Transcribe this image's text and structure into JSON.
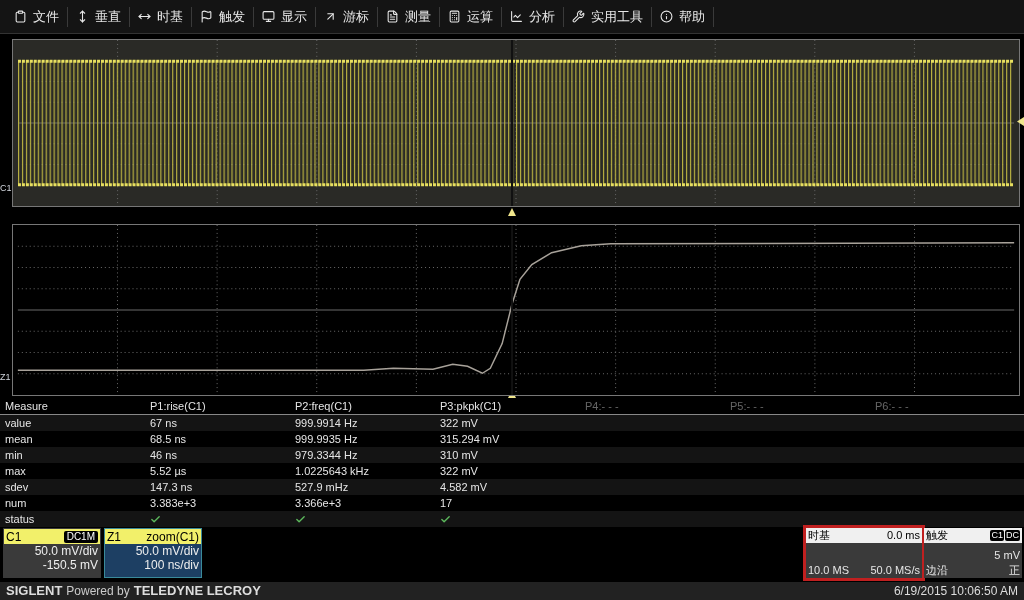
{
  "menu": [
    {
      "label": "文件"
    },
    {
      "label": "垂直"
    },
    {
      "label": "时基"
    },
    {
      "label": "触发"
    },
    {
      "label": "显示"
    },
    {
      "label": "游标"
    },
    {
      "label": "测量"
    },
    {
      "label": "运算"
    },
    {
      "label": "分析"
    },
    {
      "label": "实用工具"
    },
    {
      "label": "帮助"
    }
  ],
  "waveforms": [
    {
      "label": "C1",
      "kind": "square"
    },
    {
      "label": "Z1",
      "kind": "edge"
    }
  ],
  "measure": {
    "columns": [
      {
        "label": "Measure",
        "active": true
      },
      {
        "label": "P1:rise(C1)",
        "active": true
      },
      {
        "label": "P2:freq(C1)",
        "active": true
      },
      {
        "label": "P3:pkpk(C1)",
        "active": true
      },
      {
        "label": "P4:- - -",
        "active": false
      },
      {
        "label": "P5:- - -",
        "active": false
      },
      {
        "label": "P6:- - -",
        "active": false
      }
    ],
    "rows": [
      {
        "cells": [
          "value",
          "67 ns",
          "999.9914 Hz",
          "322 mV"
        ]
      },
      {
        "cells": [
          "mean",
          "68.5 ns",
          "999.9935 Hz",
          "315.294 mV"
        ]
      },
      {
        "cells": [
          "min",
          "46 ns",
          "979.3344 Hz",
          "310 mV"
        ]
      },
      {
        "cells": [
          "max",
          "5.52 µs",
          "1.0225643 kHz",
          "322 mV"
        ]
      },
      {
        "cells": [
          "sdev",
          "147.3 ns",
          "527.9 mHz",
          "4.582 mV"
        ]
      },
      {
        "cells": [
          "num",
          "3.383e+3",
          "3.366e+3",
          "17"
        ]
      }
    ],
    "status": {
      "label": "status",
      "checks": [
        true,
        true,
        true
      ]
    }
  },
  "channels": [
    {
      "name": "C1",
      "tag": "DC1M",
      "lines": [
        "50.0 mV/div",
        "-150.5 mV"
      ],
      "selected": false
    },
    {
      "name": "Z1",
      "tag": "zoom(C1)",
      "lines": [
        "50.0 mV/div",
        "100 ns/div"
      ],
      "selected": true
    }
  ],
  "timebase": {
    "title": "时基",
    "value": "0.0 ms",
    "rows": [
      {
        "left": "10.0 MS",
        "right": "50.0 MS/s"
      }
    ],
    "highlighted": true
  },
  "trigger": {
    "title": "触发",
    "tags": [
      "C1",
      "DC"
    ],
    "rows": [
      {
        "right": "5 mV"
      },
      {
        "left": "边沿",
        "right": "正"
      }
    ]
  },
  "footer": {
    "brand": "SIGLENT",
    "powered": "Powered by",
    "partner": "TELEDYNE LECROY",
    "datetime": "6/19/2015 10:06:50 AM"
  }
}
